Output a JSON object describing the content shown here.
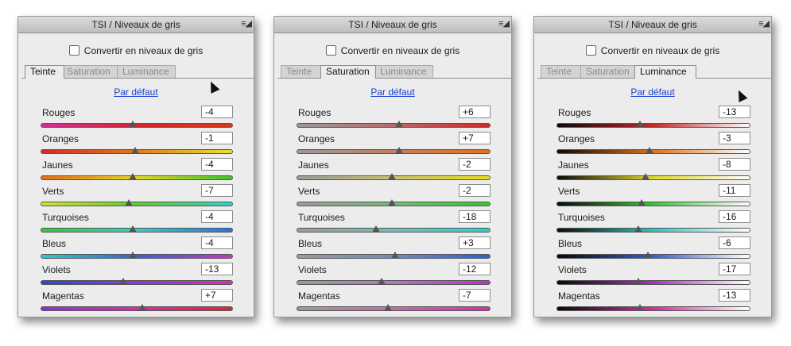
{
  "panels": [
    {
      "title": "TSI / Niveaux de gris",
      "convert_label": "Convertir en niveaux de gris",
      "tabs": [
        "Teinte",
        "Saturation",
        "Luminance"
      ],
      "active_tab": 0,
      "reset_label": "Par défaut",
      "sliders": [
        {
          "label": "Rouges",
          "value": "-4",
          "level": 0.48,
          "gradient": [
            "#d22f9a",
            "#d4262c",
            "#d43a1a"
          ]
        },
        {
          "label": "Oranges",
          "value": "-1",
          "level": 0.49,
          "gradient": [
            "#d32a2a",
            "#e07a1e",
            "#e8e23a"
          ]
        },
        {
          "label": "Jaunes",
          "value": "-4",
          "level": 0.48,
          "gradient": [
            "#e36a1c",
            "#e6d61e",
            "#3ec42d"
          ]
        },
        {
          "label": "Verts",
          "value": "-7",
          "level": 0.46,
          "gradient": [
            "#d8e02a",
            "#62cb30",
            "#36cfc8"
          ]
        },
        {
          "label": "Turquoises",
          "value": "-4",
          "level": 0.48,
          "gradient": [
            "#3bc636",
            "#3fc9c1",
            "#2f6fd6"
          ]
        },
        {
          "label": "Bleus",
          "value": "-4",
          "level": 0.48,
          "gradient": [
            "#2ec9c6",
            "#3562d6",
            "#c934c5"
          ]
        },
        {
          "label": "Violets",
          "value": "-13",
          "level": 0.43,
          "gradient": [
            "#2c48d4",
            "#8a3bd2",
            "#d532b6"
          ]
        },
        {
          "label": "Magentas",
          "value": "+7",
          "level": 0.53,
          "gradient": [
            "#8c33d0",
            "#d22fa6",
            "#d22b33"
          ]
        }
      ]
    },
    {
      "title": "TSI / Niveaux de gris",
      "convert_label": "Convertir en niveaux de gris",
      "tabs": [
        "Teinte",
        "Saturation",
        "Luminance"
      ],
      "active_tab": 1,
      "reset_label": "Par défaut",
      "sliders": [
        {
          "label": "Rouges",
          "value": "+6",
          "level": 0.53,
          "gradient": [
            "#9a9a9a",
            "#b86a6a",
            "#d42727"
          ]
        },
        {
          "label": "Oranges",
          "value": "+7",
          "level": 0.53,
          "gradient": [
            "#9a9a9a",
            "#c08060",
            "#e0711c"
          ]
        },
        {
          "label": "Jaunes",
          "value": "-2",
          "level": 0.49,
          "gradient": [
            "#9a9a9a",
            "#c8c070",
            "#e8de1e"
          ]
        },
        {
          "label": "Verts",
          "value": "-2",
          "level": 0.49,
          "gradient": [
            "#9a9a9a",
            "#78b878",
            "#36c832"
          ]
        },
        {
          "label": "Turquoises",
          "value": "-18",
          "level": 0.41,
          "gradient": [
            "#9a9a9a",
            "#78bcb8",
            "#2ecfc6"
          ]
        },
        {
          "label": "Bleus",
          "value": "+3",
          "level": 0.51,
          "gradient": [
            "#9a9a9a",
            "#6e8cc0",
            "#2a5ed6"
          ]
        },
        {
          "label": "Violets",
          "value": "-12",
          "level": 0.44,
          "gradient": [
            "#9a9a9a",
            "#b078c0",
            "#c02cd0"
          ]
        },
        {
          "label": "Magentas",
          "value": "-7",
          "level": 0.47,
          "gradient": [
            "#9a9a9a",
            "#bc70a8",
            "#d82fa0"
          ]
        }
      ]
    },
    {
      "title": "TSI / Niveaux de gris",
      "convert_label": "Convertir en niveaux de gris",
      "tabs": [
        "Teinte",
        "Saturation",
        "Luminance"
      ],
      "active_tab": 2,
      "reset_label": "Par défaut",
      "sliders": [
        {
          "label": "Rouges",
          "value": "-13",
          "level": 0.43,
          "gradient": [
            "#0a0a0a",
            "#c42828",
            "#ffffff"
          ]
        },
        {
          "label": "Oranges",
          "value": "-3",
          "level": 0.48,
          "gradient": [
            "#0a0a0a",
            "#d8731e",
            "#ffffff"
          ]
        },
        {
          "label": "Jaunes",
          "value": "-8",
          "level": 0.46,
          "gradient": [
            "#0a0a0a",
            "#e2d82a",
            "#ffffff"
          ]
        },
        {
          "label": "Verts",
          "value": "-11",
          "level": 0.44,
          "gradient": [
            "#0a0a0a",
            "#3ec23a",
            "#ffffff"
          ]
        },
        {
          "label": "Turquoises",
          "value": "-16",
          "level": 0.42,
          "gradient": [
            "#0a0a0a",
            "#32c4bc",
            "#ffffff"
          ]
        },
        {
          "label": "Bleus",
          "value": "-6",
          "level": 0.47,
          "gradient": [
            "#0a0a0a",
            "#3060d2",
            "#ffffff"
          ]
        },
        {
          "label": "Violets",
          "value": "-17",
          "level": 0.42,
          "gradient": [
            "#0a0a0a",
            "#b02cc8",
            "#ffffff"
          ]
        },
        {
          "label": "Magentas",
          "value": "-13",
          "level": 0.43,
          "gradient": [
            "#0a0a0a",
            "#d22e9a",
            "#ffffff"
          ]
        }
      ]
    }
  ]
}
